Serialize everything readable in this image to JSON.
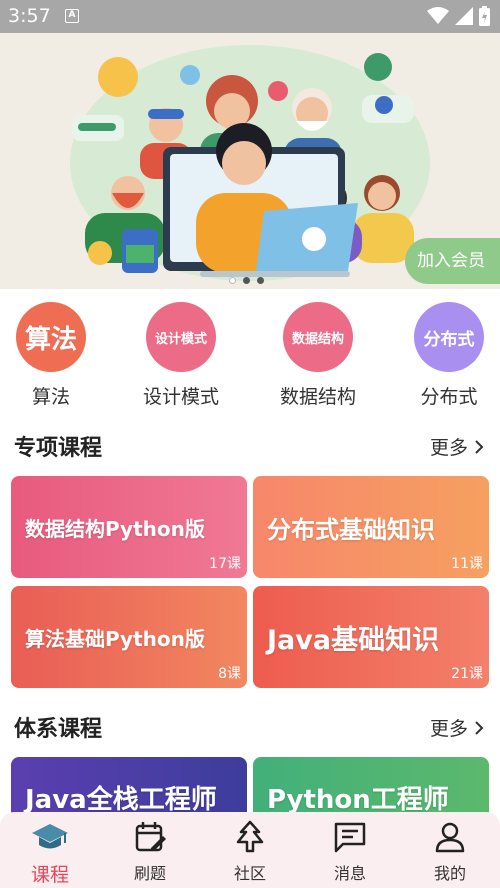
{
  "status": {
    "time": "3:57",
    "indicator": "A"
  },
  "banner": {
    "join_label": "加入会员",
    "slide_count": 3,
    "active_slide": 1
  },
  "categories": [
    {
      "icon_text": "算法",
      "label": "算法"
    },
    {
      "icon_text": "设计模式",
      "label": "设计模式"
    },
    {
      "icon_text": "数据结构",
      "label": "数据结构"
    },
    {
      "icon_text": "分布式",
      "label": "分布式"
    }
  ],
  "special": {
    "title": "专项课程",
    "more": "更多",
    "cards": [
      {
        "title": "数据结构Python版",
        "count": "17课",
        "color": "#ec6b86"
      },
      {
        "title": "分布式基础知识",
        "count": "11课",
        "color": "#f59066"
      },
      {
        "title": "算法基础Python版",
        "count": "8课",
        "color": "#ef6e57"
      },
      {
        "title": "Java基础知识",
        "count": "21课",
        "color": "#f06a4f"
      }
    ]
  },
  "system": {
    "title": "体系课程",
    "more": "更多",
    "cards": [
      {
        "title": "Java全栈工程师",
        "color": "#4a3aa2"
      },
      {
        "title": "Python工程师",
        "color": "#4aaf73"
      }
    ]
  },
  "nav": [
    {
      "label": "课程",
      "icon": "graduation-cap-icon",
      "active": true
    },
    {
      "label": "刷题",
      "icon": "edit-calendar-icon",
      "active": false
    },
    {
      "label": "社区",
      "icon": "tree-icon",
      "active": false
    },
    {
      "label": "消息",
      "icon": "message-icon",
      "active": false
    },
    {
      "label": "我的",
      "icon": "person-icon",
      "active": false
    }
  ],
  "colors": {
    "accent": "#e6475a",
    "nav_bg": "#fbeef0",
    "status_bar": "#a7a7a7"
  }
}
